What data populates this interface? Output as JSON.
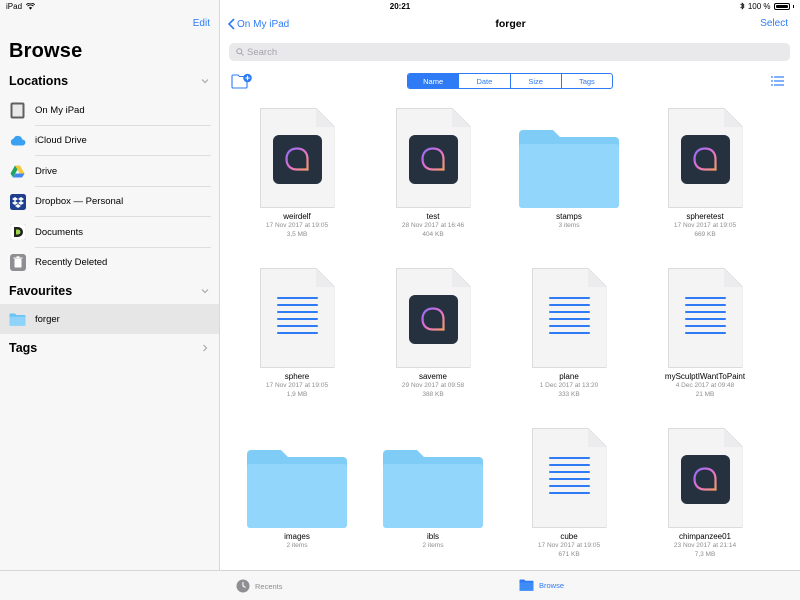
{
  "status": {
    "device": "iPad",
    "time": "20:21",
    "battery": "100 %"
  },
  "sidebar": {
    "edit_label": "Edit",
    "title": "Browse",
    "locations_header": "Locations",
    "locations": [
      {
        "label": "On My iPad",
        "icon": "ipad-icon"
      },
      {
        "label": "iCloud Drive",
        "icon": "icloud-icon"
      },
      {
        "label": "Drive",
        "icon": "google-drive-icon"
      },
      {
        "label": "Dropbox — Personal",
        "icon": "dropbox-icon"
      },
      {
        "label": "Documents",
        "icon": "documents-app-icon"
      },
      {
        "label": "Recently Deleted",
        "icon": "trash-icon"
      }
    ],
    "favourites_header": "Favourites",
    "favourites": [
      {
        "label": "forger",
        "icon": "folder-icon"
      }
    ],
    "tags_header": "Tags"
  },
  "main": {
    "back_label": "On My iPad",
    "title": "forger",
    "select_label": "Select",
    "search_placeholder": "Search",
    "sort_options": [
      "Name",
      "Date",
      "Size",
      "Tags"
    ],
    "sort_active": "Name",
    "items": [
      {
        "name": "weirdelf",
        "date": "17 Nov 2017 at 19:05",
        "size": "3,5 MB",
        "kind": "app"
      },
      {
        "name": "test",
        "date": "28 Nov 2017 at 16:46",
        "size": "404 KB",
        "kind": "app"
      },
      {
        "name": "stamps",
        "date": "3 items",
        "size": "",
        "kind": "folder"
      },
      {
        "name": "spheretest",
        "date": "17 Nov 2017 at 19:05",
        "size": "669 KB",
        "kind": "app"
      },
      {
        "name": "sphere",
        "date": "17 Nov 2017 at 19:05",
        "size": "1,9 MB",
        "kind": "text"
      },
      {
        "name": "saveme",
        "date": "29 Nov 2017 at 09:58",
        "size": "388 KB",
        "kind": "app"
      },
      {
        "name": "plane",
        "date": "1 Dec 2017 at 13:20",
        "size": "333 KB",
        "kind": "text"
      },
      {
        "name": "mySculptIWantToPaint",
        "date": "4 Dec 2017 at 09:48",
        "size": "21 MB",
        "kind": "text"
      },
      {
        "name": "images",
        "date": "2 items",
        "size": "",
        "kind": "folder"
      },
      {
        "name": "ibls",
        "date": "2 items",
        "size": "",
        "kind": "folder"
      },
      {
        "name": "cube",
        "date": "17 Nov 2017 at 19:05",
        "size": "671 KB",
        "kind": "text"
      },
      {
        "name": "chimpanzee01",
        "date": "23 Nov 2017 at 21:14",
        "size": "7,3 MB",
        "kind": "app"
      }
    ]
  },
  "tabbar": {
    "recents_label": "Recents",
    "browse_label": "Browse"
  },
  "colors": {
    "accent": "#2f7bf5",
    "folder": "#8fd3fb",
    "app_icon_bg": "#263140"
  }
}
